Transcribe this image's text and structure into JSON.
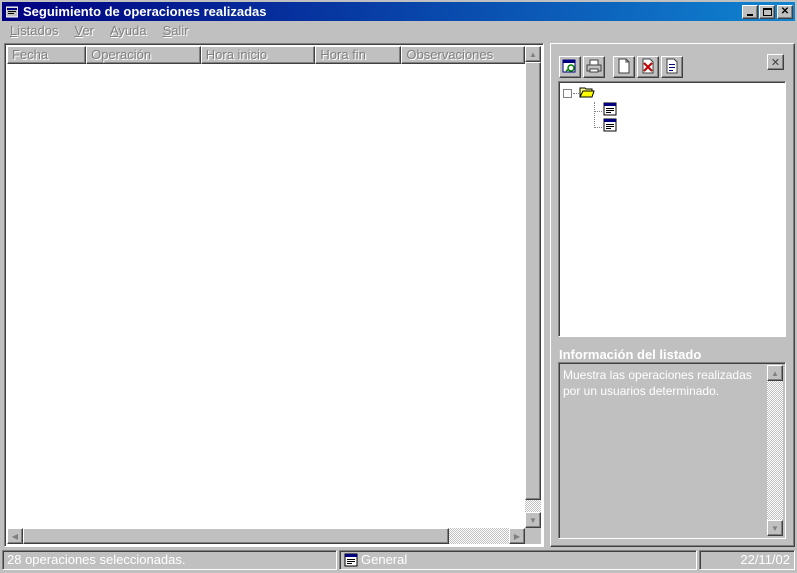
{
  "window": {
    "title": "Seguimiento de operaciones realizadas",
    "icon": "app-window-icon",
    "controls": {
      "minimize": "minimize-icon",
      "maximize": "maximize-icon",
      "close": "close-icon"
    }
  },
  "menu": {
    "items": [
      {
        "accel": "L",
        "rest": "istados"
      },
      {
        "accel": "V",
        "rest": "er"
      },
      {
        "accel": "A",
        "rest": "yuda"
      },
      {
        "accel": "S",
        "rest": "alir"
      }
    ]
  },
  "list": {
    "columns": [
      "Fecha",
      "Operación",
      "Hora inicio",
      "Hora fin",
      "Observaciones"
    ],
    "rows": []
  },
  "toolbar": {
    "buttons": [
      "preview-icon",
      "print-icon",
      "new-document-icon",
      "delete-icon",
      "properties-icon"
    ]
  },
  "tree": {
    "root_icon": "folder-open-icon",
    "children": [
      "report-icon",
      "report-icon"
    ]
  },
  "info": {
    "label": "Información del listado",
    "text": "Muestra las operaciones realizadas por un usuarios determinado."
  },
  "status": {
    "message": "28 operaciones seleccionadas.",
    "section": "General",
    "date": "22/11/02"
  },
  "colors": {
    "titlebar_start": "#000080",
    "titlebar_end": "#1084d0",
    "face": "#c0c0c0",
    "disabled_text": "#808080"
  }
}
